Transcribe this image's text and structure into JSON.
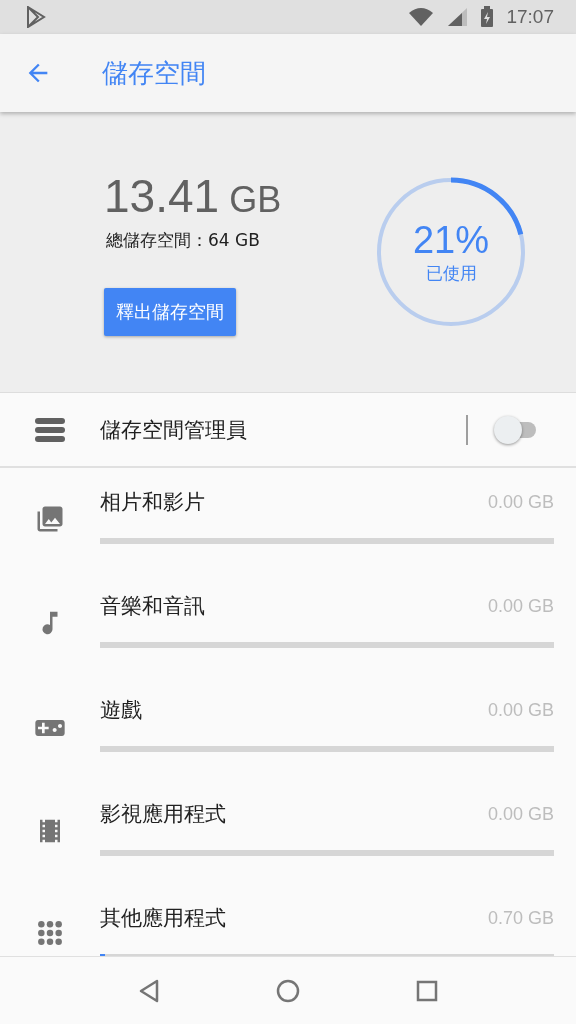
{
  "status_bar": {
    "time": "17:07"
  },
  "app_bar": {
    "title": "儲存空間"
  },
  "summary": {
    "used": "13.41",
    "unit": "GB",
    "total": "總儲存空間：64 GB",
    "button": "釋出儲存空間",
    "percent": "21%",
    "percent_label": "已使用",
    "level": 0.21
  },
  "manager": {
    "label": "儲存空間管理員",
    "on": false
  },
  "categories": [
    {
      "kind": "photos",
      "label": "相片和影片",
      "size": "0.00 GB",
      "level": 0
    },
    {
      "kind": "music",
      "label": "音樂和音訊",
      "size": "0.00 GB",
      "level": 0
    },
    {
      "kind": "games",
      "label": "遊戲",
      "size": "0.00 GB",
      "level": 0
    },
    {
      "kind": "movies",
      "label": "影視應用程式",
      "size": "0.00 GB",
      "level": 0
    },
    {
      "kind": "apps",
      "label": "其他應用程式",
      "size": "0.70 GB",
      "level": 0.011
    }
  ]
}
